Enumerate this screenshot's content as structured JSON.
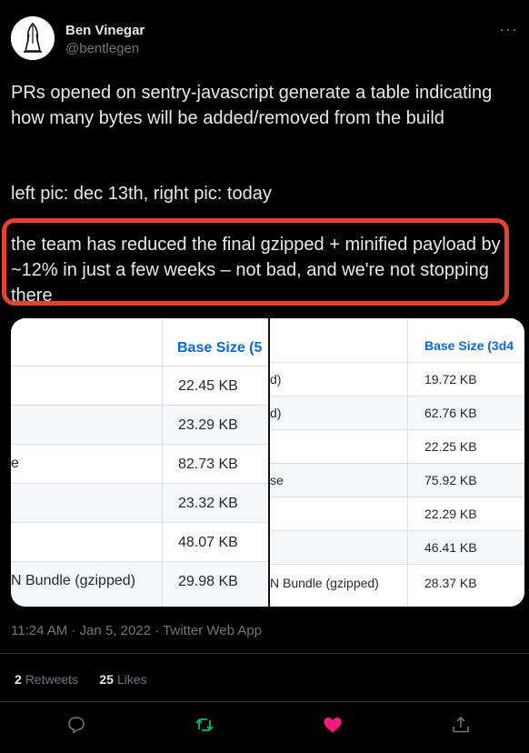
{
  "author": {
    "name": "Ben Vinegar",
    "handle": "@bentlegen"
  },
  "tweet": {
    "para1": "PRs opened on sentry-javascript generate a table indicating how many bytes will be added/removed from the build",
    "para2": "left pic: dec 13th, right pic: today",
    "para3": "the team has reduced the final gzipped + minified payload by ~12% in just a few weeks – not bad, and we're not stopping there"
  },
  "images": {
    "left": {
      "header": "Base Size (5",
      "labels": [
        "",
        "",
        "e",
        "",
        "",
        "N Bundle (gzipped)"
      ],
      "values": [
        "22.45 KB",
        "23.29 KB",
        "82.73 KB",
        "23.32 KB",
        "48.07 KB",
        "29.98 KB"
      ]
    },
    "right": {
      "header": "Base Size (3d4",
      "labels": [
        "d)",
        "d)",
        "",
        "se",
        "",
        "",
        "N Bundle (gzipped)"
      ],
      "values": [
        "19.72 KB",
        "62.76 KB",
        "22.25 KB",
        "75.92 KB",
        "22.29 KB",
        "46.41 KB",
        "28.37 KB"
      ]
    }
  },
  "meta": {
    "timestamp": "11:24 AM · Jan 5, 2022 · Twitter Web App"
  },
  "stats": {
    "retweets_count": "2",
    "retweets_label": "Retweets",
    "likes_count": "25",
    "likes_label": "Likes"
  },
  "icons": {
    "reply": "reply-icon",
    "retweet": "retweet-icon",
    "like": "heart-icon",
    "share": "share-icon"
  },
  "colors": {
    "background": "#000000",
    "highlight_border": "#e4442f",
    "table_header": "#0969da",
    "retweet": "#00ba7c",
    "like": "#f91880"
  }
}
